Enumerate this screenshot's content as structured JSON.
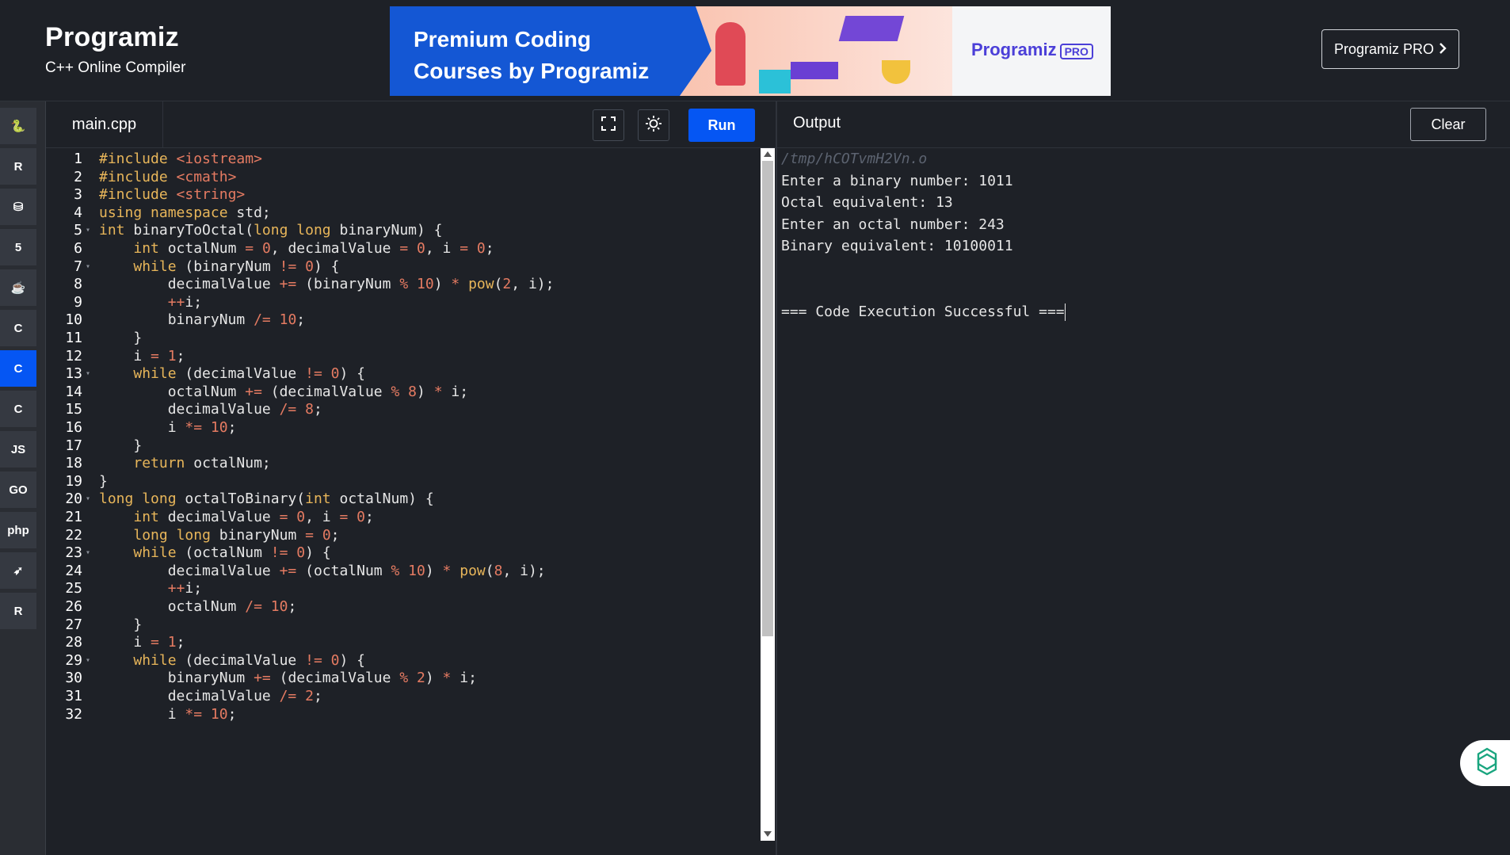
{
  "header": {
    "brand_name": "Programiz",
    "brand_subtitle": "C++ Online Compiler",
    "banner": {
      "headline_line1": "Premium Coding",
      "headline_line2": "Courses by Programiz",
      "logo_text": "Programiz",
      "logo_badge": "PRO"
    },
    "pro_button_label": "Programiz PRO",
    "pro_button_icon": "chevron-right-icon"
  },
  "sidebar": {
    "languages": [
      {
        "name": "python",
        "icon": "python-icon",
        "glyph": "🐍",
        "active": false
      },
      {
        "name": "r",
        "icon": "r-icon",
        "glyph": "R",
        "active": false
      },
      {
        "name": "sql",
        "icon": "database-icon",
        "glyph": "⛁",
        "active": false
      },
      {
        "name": "html",
        "icon": "html5-icon",
        "glyph": "5",
        "active": false
      },
      {
        "name": "java",
        "icon": "java-icon",
        "glyph": "☕",
        "active": false
      },
      {
        "name": "c",
        "icon": "c-icon",
        "glyph": "C",
        "active": false
      },
      {
        "name": "cpp",
        "icon": "cpp-icon",
        "glyph": "C",
        "active": true
      },
      {
        "name": "csharp",
        "icon": "csharp-icon",
        "glyph": "C",
        "active": false
      },
      {
        "name": "javascript",
        "icon": "js-icon",
        "glyph": "JS",
        "active": false
      },
      {
        "name": "go",
        "icon": "go-icon",
        "glyph": "GO",
        "active": false
      },
      {
        "name": "php",
        "icon": "php-icon",
        "glyph": "php",
        "active": false
      },
      {
        "name": "swift",
        "icon": "swift-icon",
        "glyph": "➶",
        "active": false
      },
      {
        "name": "rust",
        "icon": "rust-icon",
        "glyph": "R",
        "active": false
      }
    ]
  },
  "editor": {
    "tab_label": "main.cpp",
    "fullscreen_icon": "fullscreen-icon",
    "theme_icon": "sun-icon",
    "run_label": "Run",
    "lines": [
      {
        "n": "1",
        "fold": false,
        "code": "#include <iostream>"
      },
      {
        "n": "2",
        "fold": false,
        "code": "#include <cmath>"
      },
      {
        "n": "3",
        "fold": false,
        "code": "#include <string>"
      },
      {
        "n": "4",
        "fold": false,
        "code": "using namespace std;"
      },
      {
        "n": "5",
        "fold": true,
        "code": "int binaryToOctal(long long binaryNum) {"
      },
      {
        "n": "6",
        "fold": false,
        "code": "    int octalNum = 0, decimalValue = 0, i = 0;"
      },
      {
        "n": "7",
        "fold": true,
        "code": "    while (binaryNum != 0) {"
      },
      {
        "n": "8",
        "fold": false,
        "code": "        decimalValue += (binaryNum % 10) * pow(2, i);"
      },
      {
        "n": "9",
        "fold": false,
        "code": "        ++i;"
      },
      {
        "n": "10",
        "fold": false,
        "code": "        binaryNum /= 10;"
      },
      {
        "n": "11",
        "fold": false,
        "code": "    }"
      },
      {
        "n": "12",
        "fold": false,
        "code": "    i = 1;"
      },
      {
        "n": "13",
        "fold": true,
        "code": "    while (decimalValue != 0) {"
      },
      {
        "n": "14",
        "fold": false,
        "code": "        octalNum += (decimalValue % 8) * i;"
      },
      {
        "n": "15",
        "fold": false,
        "code": "        decimalValue /= 8;"
      },
      {
        "n": "16",
        "fold": false,
        "code": "        i *= 10;"
      },
      {
        "n": "17",
        "fold": false,
        "code": "    }"
      },
      {
        "n": "18",
        "fold": false,
        "code": "    return octalNum;"
      },
      {
        "n": "19",
        "fold": false,
        "code": "}"
      },
      {
        "n": "20",
        "fold": true,
        "code": "long long octalToBinary(int octalNum) {"
      },
      {
        "n": "21",
        "fold": false,
        "code": "    int decimalValue = 0, i = 0;"
      },
      {
        "n": "22",
        "fold": false,
        "code": "    long long binaryNum = 0;"
      },
      {
        "n": "23",
        "fold": true,
        "code": "    while (octalNum != 0) {"
      },
      {
        "n": "24",
        "fold": false,
        "code": "        decimalValue += (octalNum % 10) * pow(8, i);"
      },
      {
        "n": "25",
        "fold": false,
        "code": "        ++i;"
      },
      {
        "n": "26",
        "fold": false,
        "code": "        octalNum /= 10;"
      },
      {
        "n": "27",
        "fold": false,
        "code": "    }"
      },
      {
        "n": "28",
        "fold": false,
        "code": "    i = 1;"
      },
      {
        "n": "29",
        "fold": true,
        "code": "    while (decimalValue != 0) {"
      },
      {
        "n": "30",
        "fold": false,
        "code": "        binaryNum += (decimalValue % 2) * i;"
      },
      {
        "n": "31",
        "fold": false,
        "code": "        decimalValue /= 2;"
      },
      {
        "n": "32",
        "fold": false,
        "code": "        i *= 10;"
      }
    ]
  },
  "output": {
    "title": "Output",
    "clear_label": "Clear",
    "path": "/tmp/hCOTvmH2Vn.o",
    "lines": [
      "Enter a binary number: 1011",
      "Octal equivalent: 13",
      "Enter an octal number: 243",
      "Binary equivalent: 10100011",
      "",
      "",
      "=== Code Execution Successful ==="
    ]
  },
  "assistant_button_icon": "ai-assistant-icon",
  "colors": {
    "accent": "#0556f3",
    "background": "#1e2127",
    "keyword": "#e8b65a",
    "literal": "#e57b62"
  }
}
